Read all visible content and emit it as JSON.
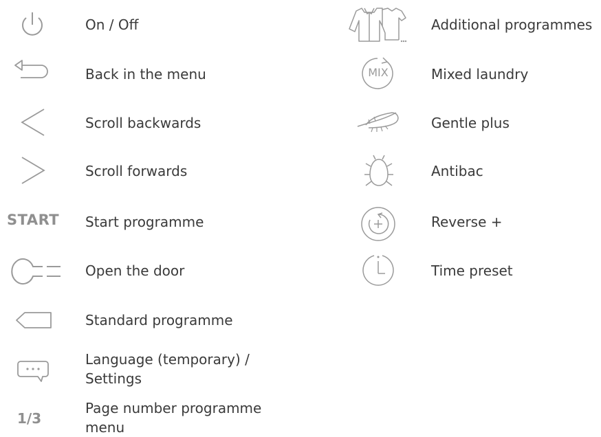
{
  "left_column": [
    {
      "icon": "power-icon",
      "label": "On / Off"
    },
    {
      "icon": "back-arrow-icon",
      "label": "Back in the menu"
    },
    {
      "icon": "chevron-left-icon",
      "label": "Scroll backwards"
    },
    {
      "icon": "chevron-right-icon",
      "label": "Scroll forwards"
    },
    {
      "icon_text": "START",
      "label": "Start programme"
    },
    {
      "icon": "key-icon",
      "label": "Open the door"
    },
    {
      "icon": "tag-icon",
      "label": "Standard programme"
    },
    {
      "icon": "speech-bubble-icon",
      "label_line1": "Language (temporary) /",
      "label_line2": "Settings"
    },
    {
      "icon_text": "1/3",
      "label_line1": "Page number programme",
      "label_line2": "menu"
    }
  ],
  "right_column": [
    {
      "icon": "clothes-icon",
      "label": "Additional programmes"
    },
    {
      "icon_text": "MIX",
      "label": "Mixed laundry"
    },
    {
      "icon": "feather-icon",
      "label": "Gentle plus"
    },
    {
      "icon": "bug-icon",
      "label": "Antibac"
    },
    {
      "icon": "reverse-plus-icon",
      "label": "Reverse +"
    },
    {
      "icon": "timer-icon",
      "label": "Time preset"
    }
  ],
  "colors": {
    "icon": "#9a9a9a",
    "text": "#3a3a3a"
  }
}
